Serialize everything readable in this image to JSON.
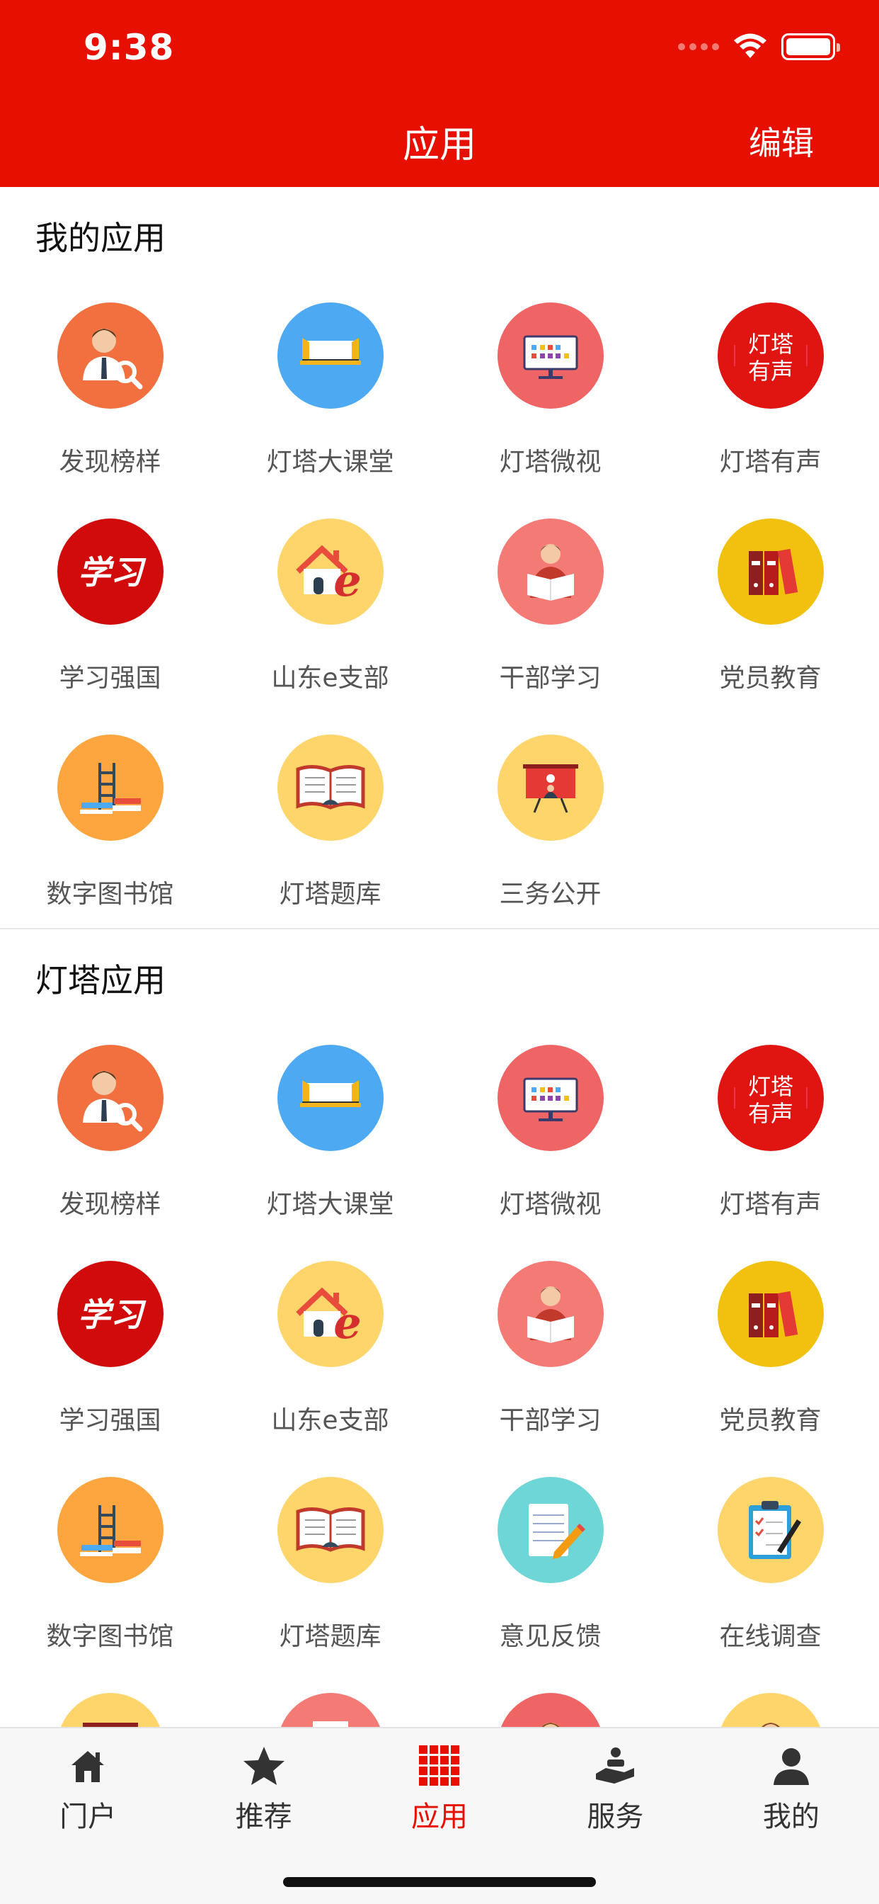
{
  "status": {
    "time": "9:38"
  },
  "header": {
    "title": "应用",
    "edit_label": "编辑"
  },
  "sections": {
    "my_apps": {
      "title": "我的应用",
      "items": [
        {
          "label": "发现榜样",
          "icon": "person-search-icon",
          "color": "#f2703f"
        },
        {
          "label": "灯塔大课堂",
          "icon": "classroom-icon",
          "color": "#4da9f2"
        },
        {
          "label": "灯塔微视",
          "icon": "monitor-icon",
          "color": "#ef6465"
        },
        {
          "label": "灯塔有声",
          "icon": "audio-text-icon",
          "color": "#e01410",
          "glyph_text": "灯塔有声"
        },
        {
          "label": "学习强国",
          "icon": "xuexi-logo-icon",
          "color": "#d10b0b",
          "glyph_text": "学习"
        },
        {
          "label": "山东e支部",
          "icon": "house-e-icon",
          "color": "#fdd56a"
        },
        {
          "label": "干部学习",
          "icon": "reader-icon",
          "color": "#f47a76"
        },
        {
          "label": "党员教育",
          "icon": "binders-icon",
          "color": "#f2c00e"
        },
        {
          "label": "数字图书馆",
          "icon": "library-ladder-icon",
          "color": "#fda53e"
        },
        {
          "label": "灯塔题库",
          "icon": "open-book-icon",
          "color": "#fdd56a"
        },
        {
          "label": "三务公开",
          "icon": "presentation-board-icon",
          "color": "#fdd56a"
        }
      ]
    },
    "lighthouse_apps": {
      "title": "灯塔应用",
      "items": [
        {
          "label": "发现榜样",
          "icon": "person-search-icon",
          "color": "#f2703f"
        },
        {
          "label": "灯塔大课堂",
          "icon": "classroom-icon",
          "color": "#4da9f2"
        },
        {
          "label": "灯塔微视",
          "icon": "monitor-icon",
          "color": "#ef6465"
        },
        {
          "label": "灯塔有声",
          "icon": "audio-text-icon",
          "color": "#e01410",
          "glyph_text": "灯塔有声"
        },
        {
          "label": "学习强国",
          "icon": "xuexi-logo-icon",
          "color": "#d10b0b",
          "glyph_text": "学习"
        },
        {
          "label": "山东e支部",
          "icon": "house-e-icon",
          "color": "#fdd56a"
        },
        {
          "label": "干部学习",
          "icon": "reader-icon",
          "color": "#f47a76"
        },
        {
          "label": "党员教育",
          "icon": "binders-icon",
          "color": "#f2c00e"
        },
        {
          "label": "数字图书馆",
          "icon": "library-ladder-icon",
          "color": "#fda53e"
        },
        {
          "label": "灯塔题库",
          "icon": "open-book-icon",
          "color": "#fdd56a"
        },
        {
          "label": "意见反馈",
          "icon": "notepad-pencil-icon",
          "color": "#6fd6d8"
        },
        {
          "label": "在线调查",
          "icon": "clipboard-survey-icon",
          "color": "#fdd56a"
        },
        {
          "label": "",
          "icon": "presentation-board-icon",
          "color": "#fdd56a"
        },
        {
          "label": "",
          "icon": "document-icon",
          "color": "#f47a76"
        },
        {
          "label": "",
          "icon": "person-icon",
          "color": "#ef6465"
        },
        {
          "label": "",
          "icon": "person-icon",
          "color": "#fdd56a"
        }
      ]
    }
  },
  "tabbar": {
    "tabs": [
      {
        "label": "门户",
        "icon": "home-icon",
        "active": false
      },
      {
        "label": "推荐",
        "icon": "star-icon",
        "active": false
      },
      {
        "label": "应用",
        "icon": "grid-icon",
        "active": true
      },
      {
        "label": "服务",
        "icon": "service-icon",
        "active": false
      },
      {
        "label": "我的",
        "icon": "user-icon",
        "active": false
      }
    ]
  },
  "colors": {
    "brand_red": "#e60f00",
    "tab_active": "#e60f00",
    "tab_inactive": "#333333"
  }
}
